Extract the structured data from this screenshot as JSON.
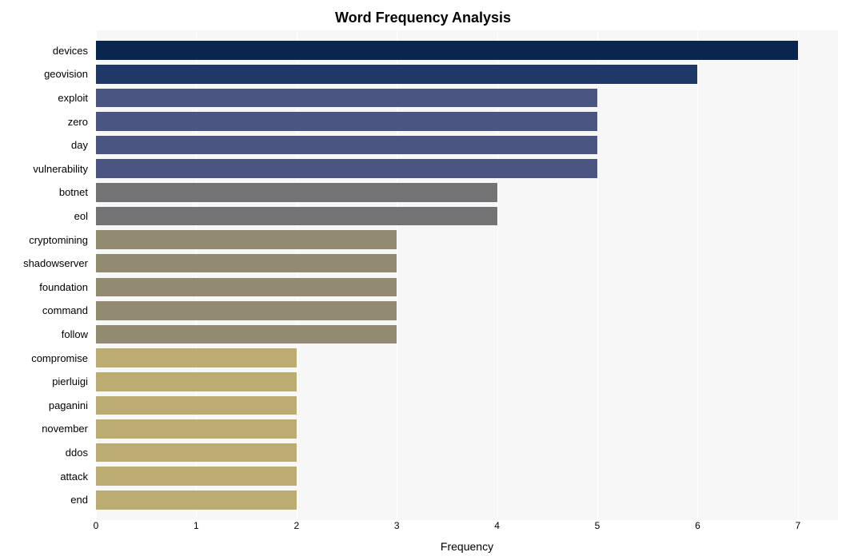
{
  "chart_data": {
    "type": "bar",
    "title": "Word Frequency Analysis",
    "xlabel": "Frequency",
    "ylabel": "",
    "xlim": [
      0,
      7.4
    ],
    "ticks": [
      0,
      1,
      2,
      3,
      4,
      5,
      6,
      7
    ],
    "categories": [
      "devices",
      "geovision",
      "exploit",
      "zero",
      "day",
      "vulnerability",
      "botnet",
      "eol",
      "cryptomining",
      "shadowserver",
      "foundation",
      "command",
      "follow",
      "compromise",
      "pierluigi",
      "paganini",
      "november",
      "ddos",
      "attack",
      "end"
    ],
    "values": [
      7,
      6,
      5,
      5,
      5,
      5,
      4,
      4,
      3,
      3,
      3,
      3,
      3,
      2,
      2,
      2,
      2,
      2,
      2,
      2
    ],
    "colors": [
      "#09264e",
      "#1f3867",
      "#4a5581",
      "#4a5581",
      "#4a5581",
      "#4a5581",
      "#737376",
      "#737376",
      "#928b72",
      "#928b72",
      "#928b72",
      "#928b72",
      "#928b72",
      "#bbad72",
      "#bbad72",
      "#bbad72",
      "#bbad72",
      "#bbad72",
      "#bbad72",
      "#bbad72"
    ]
  }
}
